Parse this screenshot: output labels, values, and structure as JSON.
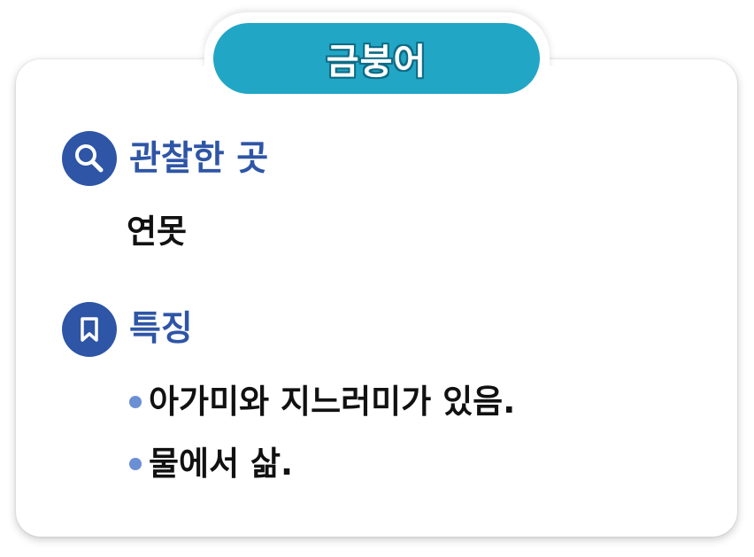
{
  "title": "금붕어",
  "sections": {
    "place": {
      "icon": "search-icon",
      "heading": "관찰한 곳",
      "value": "연못"
    },
    "features": {
      "icon": "bookmark-icon",
      "heading": "특징",
      "items": [
        "아가미와 지느러미가 있음.",
        "물에서 삶."
      ]
    }
  },
  "colors": {
    "title_pill": "#22a6c5",
    "title_outline": "#0e6c86",
    "accent": "#2e55a6",
    "bullet": "#6b8fd4",
    "text": "#111111"
  }
}
